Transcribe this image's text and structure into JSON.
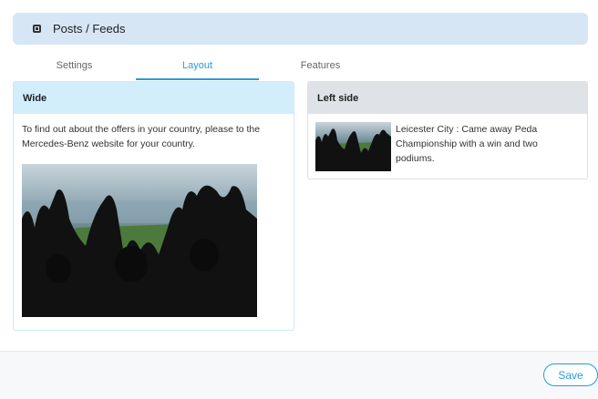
{
  "header": {
    "title": "Posts / Feeds",
    "icon": "widget-icon"
  },
  "tabs": [
    {
      "label": "Settings",
      "active": false
    },
    {
      "label": "Layout",
      "active": true
    },
    {
      "label": "Features",
      "active": false
    }
  ],
  "wide_card": {
    "title": "Wide",
    "text": "To find out about the offers in your country, please to the Mercedes-Benz website for your country."
  },
  "left_card": {
    "title": "Left side",
    "text": "Leicester City : Came away Peda Championship with a win and two podiums."
  },
  "footer": {
    "save_label": "Save"
  },
  "colors": {
    "accent": "#2a9bd7",
    "header_bg": "#d6e6f5",
    "wide_head_bg": "#d3eefb",
    "left_head_bg": "#dfe2e7"
  }
}
